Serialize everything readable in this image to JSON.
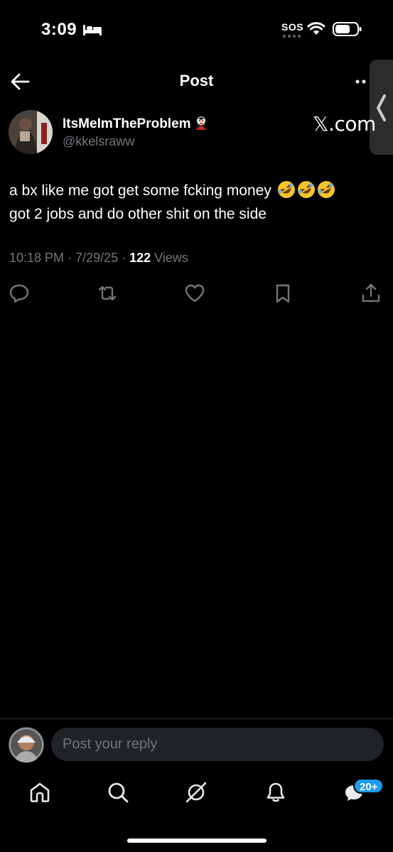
{
  "status_bar": {
    "time": "3:09",
    "sos": "SOS"
  },
  "header": {
    "title": "Post"
  },
  "author": {
    "display_name": "ItsMeImTheProblem",
    "handle": "@kkelsraww"
  },
  "brand": "𝕏.com",
  "post": {
    "line1": "a bx like me got get some fcking money",
    "line2": "got 2 jobs and do other shit on the side",
    "emoji": "rolling-on-floor-laughing-emoji",
    "time": "10:18 PM",
    "date": "7/29/25",
    "views_count": "122",
    "views_label": "Views"
  },
  "reply": {
    "placeholder": "Post your reply"
  },
  "nav": {
    "badge": "20+"
  },
  "colors": {
    "background": "#000000",
    "muted": "#71767b",
    "accent": "#1d9bf0",
    "input_bg": "#202327"
  }
}
